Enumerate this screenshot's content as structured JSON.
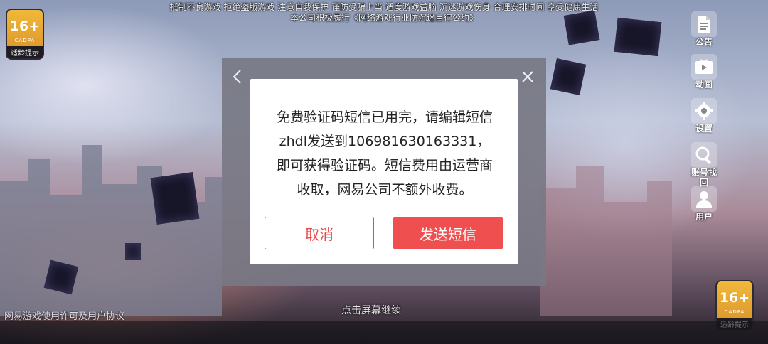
{
  "top_notice": {
    "line1": "抵制不良游戏  拒绝盗版游戏  注意自我保护  谨防受骗上当  适度游戏益脑  沉迷游戏伤身  合理安排时间  享受健康生活",
    "line2": "本公司积极履行《网络游戏行业防沉迷自律公约》"
  },
  "age_badge": {
    "rating": "16+",
    "org": "CADPA",
    "label": "适龄提示"
  },
  "side_menu": {
    "items": [
      {
        "label": "公告",
        "icon": "document-icon"
      },
      {
        "label": "动画",
        "icon": "play-icon"
      },
      {
        "label": "设置",
        "icon": "gear-icon"
      },
      {
        "label": "账号找回",
        "icon": "magnifier-icon"
      },
      {
        "label": "用户",
        "icon": "user-icon"
      }
    ]
  },
  "footer": {
    "license_link": "网易游戏使用许可及用户协议",
    "tap_hint": "点击屏幕继续"
  },
  "dialog": {
    "message": "免费验证码短信已用完，请编辑短信zhdl发送到106981630163331，即可获得验证码。短信费用由运营商收取，网易公司不额外收费。",
    "cancel_label": "取消",
    "send_label": "发送短信"
  },
  "colors": {
    "accent": "#ef4f4f",
    "badge": "#e8a832"
  }
}
